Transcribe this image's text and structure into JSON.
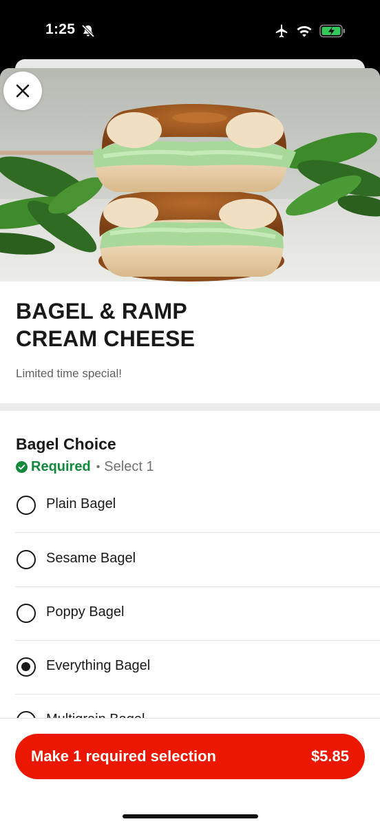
{
  "status_bar": {
    "time": "1:25",
    "icons": [
      "bell-slash-icon",
      "airplane-icon",
      "wifi-icon",
      "battery-charging-icon"
    ]
  },
  "item": {
    "title_line1": "BAGEL & RAMP",
    "title_line2": "CREAM CHEESE",
    "description": "Limited time special!"
  },
  "option_group": {
    "title": "Bagel Choice",
    "required_label": "Required",
    "separator": "•",
    "select_hint": "Select 1",
    "options": [
      {
        "label": "Plain Bagel",
        "selected": false
      },
      {
        "label": "Sesame Bagel",
        "selected": false
      },
      {
        "label": "Poppy Bagel",
        "selected": false
      },
      {
        "label": "Everything Bagel",
        "selected": true
      },
      {
        "label": "Multigrain Bagel",
        "selected": false
      }
    ]
  },
  "cta": {
    "label": "Make 1 required selection",
    "price": "$5.85"
  },
  "colors": {
    "accent": "#eb1700",
    "required_green": "#0f8a3a",
    "text": "#191919"
  }
}
